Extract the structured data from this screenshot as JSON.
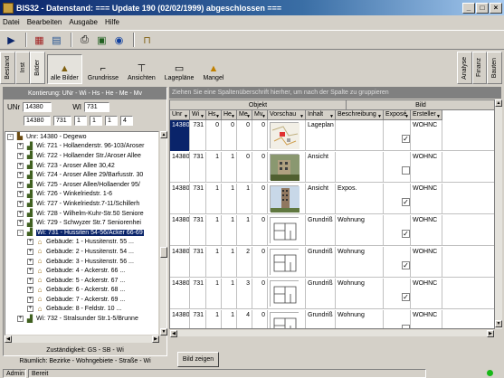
{
  "window": {
    "title": "BIS32 - Datenstand: === Update 190 (02/02/1999) abgeschlossen ==="
  },
  "menu": [
    "Datei",
    "Bearbeiten",
    "Ausgabe",
    "Hilfe"
  ],
  "left_tabs": [
    "Bestand",
    "Inst",
    "Bilder"
  ],
  "right_tabs": [
    "Analyse",
    "Finanz",
    "Bauten"
  ],
  "buttons": [
    "alle Bilder",
    "Grundrisse",
    "Ansichten",
    "Lagepläne",
    "Mangel"
  ],
  "left": {
    "header": "Kontierung: UNr - Wi - Hs - He - Me - Mv",
    "unr_label": "UNr",
    "unr_value": "14380",
    "wi_label": "WI",
    "wi_value": "731",
    "fields": [
      "14380",
      "731",
      "1",
      "1",
      "1",
      "4"
    ],
    "tree": [
      {
        "label": "Unr: 14380 - Degewo",
        "level": 0,
        "exp": "-",
        "icon": "unr"
      },
      {
        "label": "Wi: 721 - Hollaenderstr. 96-103/Aroser",
        "level": 1,
        "exp": "+",
        "icon": "wi"
      },
      {
        "label": "Wi: 722 - Hollaender Str./Aroser Allee",
        "level": 1,
        "exp": "+",
        "icon": "wi"
      },
      {
        "label": "Wi: 723 - Aroser Allee 30,42",
        "level": 1,
        "exp": "+",
        "icon": "wi"
      },
      {
        "label": "Wi: 724 - Aroser Allee 29/Barfusstr. 30",
        "level": 1,
        "exp": "+",
        "icon": "wi"
      },
      {
        "label": "Wi: 725 - Aroser Allee/Hollaender 95/",
        "level": 1,
        "exp": "+",
        "icon": "wi"
      },
      {
        "label": "Wi: 726 - Winkelriedstr. 1-6",
        "level": 1,
        "exp": "+",
        "icon": "wi"
      },
      {
        "label": "Wi: 727 - Winkelriedstr.7-11/Schillerh",
        "level": 1,
        "exp": "+",
        "icon": "wi"
      },
      {
        "label": "Wi: 728 - Wilhelm-Kuhr-Str.50 Seniore",
        "level": 1,
        "exp": "+",
        "icon": "wi"
      },
      {
        "label": "Wi: 729 - Schwyzer Str.7 Seniorenhei",
        "level": 1,
        "exp": "+",
        "icon": "wi"
      },
      {
        "label": "Wi: 731 - Hussiten 54-56/Acker 66-69",
        "level": 1,
        "exp": "-",
        "icon": "wi",
        "selected": true
      },
      {
        "label": "Gebäude: 1 - Hussitenstr. 55 ...",
        "level": 2,
        "exp": "+",
        "icon": "geb"
      },
      {
        "label": "Gebäude: 2 - Hussitenstr. 54 ...",
        "level": 2,
        "exp": "+",
        "icon": "geb"
      },
      {
        "label": "Gebäude: 3 - Hussitenstr. 56 ...",
        "level": 2,
        "exp": "+",
        "icon": "geb"
      },
      {
        "label": "Gebäude: 4 - Ackerstr. 66 ...",
        "level": 2,
        "exp": "+",
        "icon": "geb"
      },
      {
        "label": "Gebäude: 5 - Ackerstr. 67 ...",
        "level": 2,
        "exp": "+",
        "icon": "geb"
      },
      {
        "label": "Gebäude: 6 - Ackerstr. 68 ...",
        "level": 2,
        "exp": "+",
        "icon": "geb"
      },
      {
        "label": "Gebäude: 7 - Ackerstr. 69 ...",
        "level": 2,
        "exp": "+",
        "icon": "geb"
      },
      {
        "label": "Gebäude: 8 - Feldstr. 10 ...",
        "level": 2,
        "exp": "+",
        "icon": "geb"
      },
      {
        "label": "Wi: 732 - Stralsunder Str.1-5/Brunne",
        "level": 1,
        "exp": "+",
        "icon": "wi"
      }
    ],
    "footer": "Zuständigkeit: GS - SB - Wi",
    "footer2": "Räumlich: Bezirke - Wohngebiete - Straße - Wi"
  },
  "grid": {
    "group_hint": "Ziehen Sie eine Spaltenüberschrift hierher, um nach der Spalte zu gruppieren",
    "bands": [
      "Objekt",
      "Bild"
    ],
    "columns": [
      "Unr",
      "Wi",
      "Hs",
      "He",
      "Me",
      "Mv",
      "Vorschau",
      "Inhalt",
      "Beschreibung",
      "Exposé",
      "Ersteller"
    ],
    "rows": [
      {
        "unr": "14380",
        "wi": "731",
        "hs": "0",
        "he": "0",
        "me": "0",
        "mv": "0",
        "thumb": "lageplan",
        "inhalt": "Lageplan",
        "beschreibung": "",
        "expose": true,
        "ersteller": "WOHNC",
        "selected": true
      },
      {
        "unr": "14380",
        "wi": "731",
        "hs": "1",
        "he": "1",
        "me": "0",
        "mv": "0",
        "thumb": "photo",
        "inhalt": "Ansicht",
        "beschreibung": "",
        "expose": false,
        "ersteller": "WOHNC"
      },
      {
        "unr": "14380",
        "wi": "731",
        "hs": "1",
        "he": "1",
        "me": "1",
        "mv": "0",
        "thumb": "tower",
        "inhalt": "Ansicht",
        "beschreibung": "Expos.",
        "expose": true,
        "ersteller": "WOHNC"
      },
      {
        "unr": "14380",
        "wi": "731",
        "hs": "1",
        "he": "1",
        "me": "1",
        "mv": "0",
        "thumb": "plan",
        "inhalt": "Grundriß",
        "beschreibung": "Wohnung",
        "expose": true,
        "ersteller": "WOHNC"
      },
      {
        "unr": "14380",
        "wi": "731",
        "hs": "1",
        "he": "1",
        "me": "2",
        "mv": "0",
        "thumb": "plan",
        "inhalt": "Grundriß",
        "beschreibung": "Wohnung",
        "expose": true,
        "ersteller": "WOHNC"
      },
      {
        "unr": "14380",
        "wi": "731",
        "hs": "1",
        "he": "1",
        "me": "3",
        "mv": "0",
        "thumb": "plan",
        "inhalt": "Grundriß",
        "beschreibung": "Wohnung",
        "expose": true,
        "ersteller": "WOHNC"
      },
      {
        "unr": "14380",
        "wi": "731",
        "hs": "1",
        "he": "1",
        "me": "4",
        "mv": "0",
        "thumb": "plan",
        "inhalt": "Grundriß",
        "beschreibung": "Wohnung",
        "expose": false,
        "ersteller": "WOHNC"
      }
    ]
  },
  "show_button": "Bild zeigen",
  "status": {
    "user": "Admin",
    "state": "Bereit"
  }
}
